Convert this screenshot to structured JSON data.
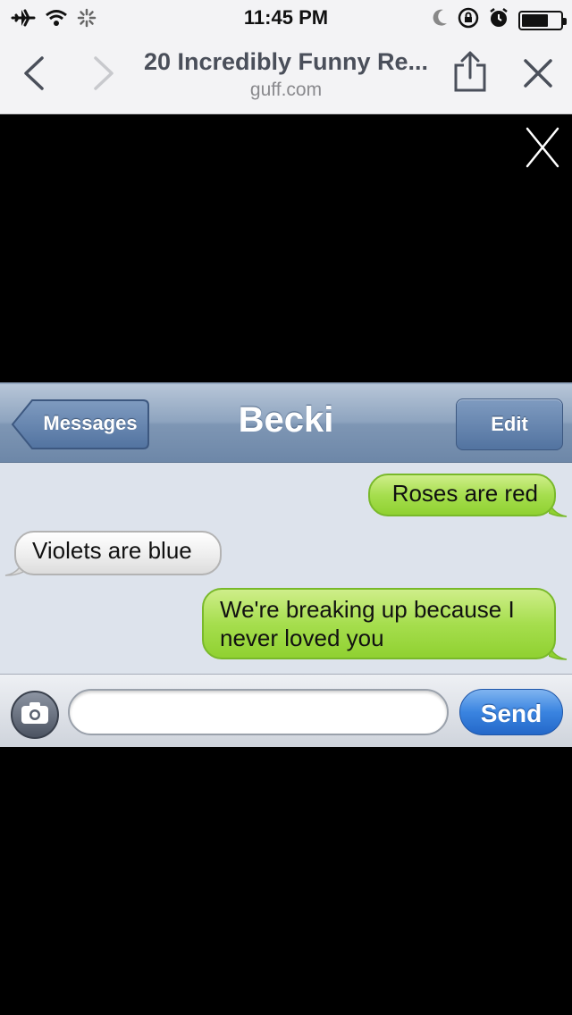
{
  "status_bar": {
    "time": "11:45 PM",
    "icons": [
      "airplane-mode-icon",
      "wifi-icon",
      "activity-spinner-icon",
      "moon-icon",
      "orientation-lock-icon",
      "alarm-icon",
      "battery-icon"
    ],
    "battery_level": 0.7
  },
  "browser": {
    "page_title": "20 Incredibly Funny Re...",
    "domain": "guff.com",
    "icons": [
      "back-chevron-icon",
      "forward-chevron-icon",
      "share-icon",
      "close-icon"
    ]
  },
  "viewer": {
    "close_icon": "close-x-icon"
  },
  "imessage": {
    "back_label": "Messages",
    "contact_name": "Becki",
    "edit_label": "Edit",
    "messages": [
      {
        "side": "right",
        "text": "Roses are red"
      },
      {
        "side": "left",
        "text": "Violets are blue"
      },
      {
        "side": "right",
        "text": "We're breaking up because I never loved you"
      }
    ],
    "compose_text": "",
    "send_label": "Send",
    "colors": {
      "sent_bubble": "#a6de4e",
      "received_bubble": "#ececec",
      "send_button": "#3a84e0",
      "nav_bar": "#8ea4bf"
    }
  }
}
